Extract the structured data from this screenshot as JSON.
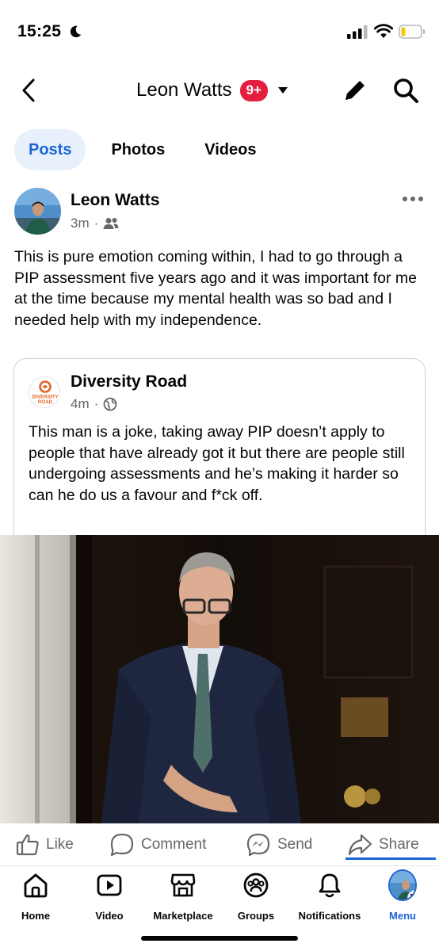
{
  "status_bar": {
    "time": "15:25",
    "icons": [
      "moon-icon",
      "signal-icon",
      "wifi-icon",
      "battery-icon"
    ]
  },
  "header": {
    "title": "Leon Watts",
    "badge": "9+",
    "icons": [
      "back-icon",
      "caret-down-icon",
      "edit-icon",
      "search-icon"
    ]
  },
  "tabs": [
    {
      "label": "Posts",
      "active": true
    },
    {
      "label": "Photos",
      "active": false
    },
    {
      "label": "Videos",
      "active": false
    }
  ],
  "post": {
    "author": "Leon Watts",
    "time": "3m",
    "audience_icon": "friends-icon",
    "text": "This is pure emotion coming within, I had to go through a PIP assessment five years ago and it was important for me at the time because my mental health was so bad and I needed help with my independence."
  },
  "shared_post": {
    "page_name": "Diversity Road",
    "logo_text": [
      "DIVERSITY",
      "ROAD"
    ],
    "time": "4m",
    "audience_icon": "globe-icon",
    "text": "This man is a joke, taking away PIP doesn’t apply to people that have already got it but there are people still undergoing assessments and he’s making it harder so can he do us a favour and f*ck off."
  },
  "actions": {
    "like": "Like",
    "comment": "Comment",
    "send": "Send",
    "share": "Share"
  },
  "bottom_nav": [
    {
      "label": "Home",
      "icon": "home-icon",
      "active": false
    },
    {
      "label": "Video",
      "icon": "video-icon",
      "active": false
    },
    {
      "label": "Marketplace",
      "icon": "marketplace-icon",
      "active": false
    },
    {
      "label": "Groups",
      "icon": "groups-icon",
      "active": false
    },
    {
      "label": "Notifications",
      "icon": "bell-icon",
      "active": false
    },
    {
      "label": "Menu",
      "icon": "menu-avatar",
      "active": true
    }
  ],
  "colors": {
    "accent": "#1a64d6",
    "badge": "#e41e3f",
    "meta_text": "#65676b",
    "active_tab_bg": "#e7f0fb",
    "logo_orange": "#e2662b"
  }
}
